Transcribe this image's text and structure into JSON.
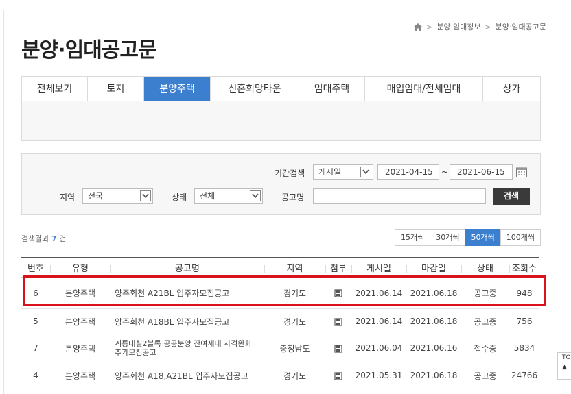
{
  "breadcrumb": [
    "분양·임대정보",
    "분양·임대공고문"
  ],
  "page_title": "분양·임대공고문",
  "tabs": [
    {
      "label": "전체보기",
      "active": false
    },
    {
      "label": "토지",
      "active": false
    },
    {
      "label": "분양주택",
      "active": true
    },
    {
      "label": "신혼희망타운",
      "active": false
    },
    {
      "label": "임대주택",
      "active": false
    },
    {
      "label": "매입임대/전세임대",
      "active": false
    },
    {
      "label": "상가",
      "active": false
    }
  ],
  "search": {
    "period_label": "기간검색",
    "period_type": "게시일",
    "date_from": "2021-04-15",
    "date_sep": "~",
    "date_to": "2021-06-15",
    "region_label": "지역",
    "region_value": "전국",
    "status_label": "상태",
    "status_value": "전체",
    "name_label": "공고명",
    "name_value": "",
    "button": "검색"
  },
  "result": {
    "prefix": "검색결과",
    "count": "7",
    "suffix": "건"
  },
  "page_sizes": [
    {
      "label": "15개씩",
      "active": false
    },
    {
      "label": "30개씩",
      "active": false
    },
    {
      "label": "50개씩",
      "active": true
    },
    {
      "label": "100개씩",
      "active": false
    }
  ],
  "table": {
    "headers": [
      "번호",
      "유형",
      "공고명",
      "지역",
      "첨부",
      "게시일",
      "마감일",
      "상태",
      "조회수"
    ],
    "rows": [
      {
        "no": "6",
        "type": "분양주택",
        "title": "양주회천 A21BL 입주자모집공고",
        "region": "경기도",
        "posted": "2021.06.14",
        "deadline": "2021.06.18",
        "status": "공고중",
        "views": "948"
      },
      {
        "no": "5",
        "type": "분양주택",
        "title": "양주회천 A18BL 입주자모집공고",
        "region": "경기도",
        "posted": "2021.06.14",
        "deadline": "2021.06.18",
        "status": "공고중",
        "views": "756"
      },
      {
        "no": "7",
        "type": "분양주택",
        "title": "계룡대실2블록 공공분양 잔여세대 자격완화 추가모집공고",
        "region": "충청남도",
        "posted": "2021.06.04",
        "deadline": "2021.06.16",
        "status": "접수중",
        "views": "5834"
      },
      {
        "no": "4",
        "type": "분양주택",
        "title": "양주회천 A18,A21BL 입주자모집공고",
        "region": "경기도",
        "posted": "2021.05.31",
        "deadline": "2021.06.18",
        "status": "공고중",
        "views": "24766"
      }
    ]
  },
  "top_button": "TO",
  "colors": {
    "accent": "#3c7fcf",
    "highlight": "#d9121c",
    "search_button": "#3a3a3a"
  }
}
